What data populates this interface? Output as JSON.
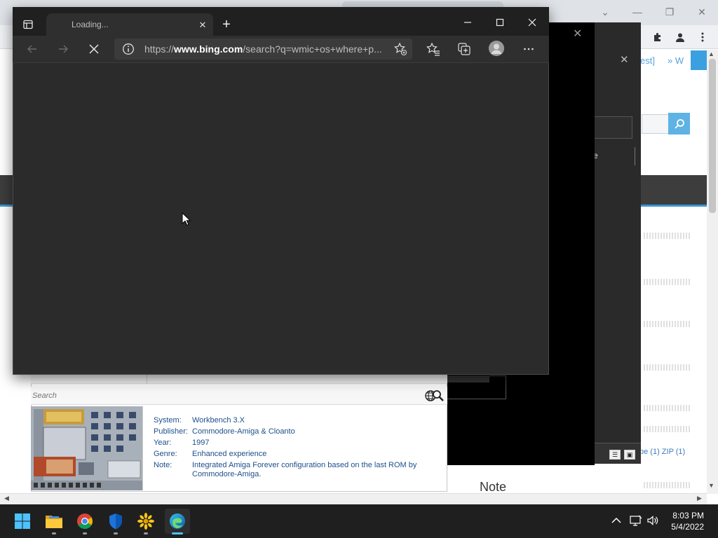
{
  "edge": {
    "tab_title": "Loading...",
    "url_prefix": "https://",
    "url_domain": "www.bing.com",
    "url_suffix": "/search?q=wmic+os+where+p..."
  },
  "amiga_panel": {
    "search_placeholder": "Search",
    "details": [
      {
        "label": "System:",
        "value": "Workbench 3.X"
      },
      {
        "label": "Publisher:",
        "value": "Commodore-Amiga & Cloanto"
      },
      {
        "label": "Year:",
        "value": "1997"
      },
      {
        "label": "Genre:",
        "value": "Enhanced experience"
      },
      {
        "label": "Note:",
        "value": "Integrated Amiga Forever configuration based on the last ROM by Commodore-Amiga."
      }
    ]
  },
  "background_page": {
    "breadcrumb_a": "est]",
    "breadcrumb_b": "» W",
    "dialog_fragment_text": "e",
    "zip_text": "pe (1) ZIP (1)",
    "note_heading": "Note"
  },
  "taskbar": {
    "apps": [
      "start-icon",
      "file-explorer-icon",
      "chrome-icon",
      "defender-icon",
      "sun-app-icon",
      "edge-icon"
    ],
    "time": "8:03 PM",
    "date": "5/4/2022"
  },
  "colors": {
    "edge_dark": "#2b2b2b",
    "accent_blue": "#3aa0e0",
    "link_blue": "#1d4f8a",
    "taskbar": "#1f1f1f"
  }
}
